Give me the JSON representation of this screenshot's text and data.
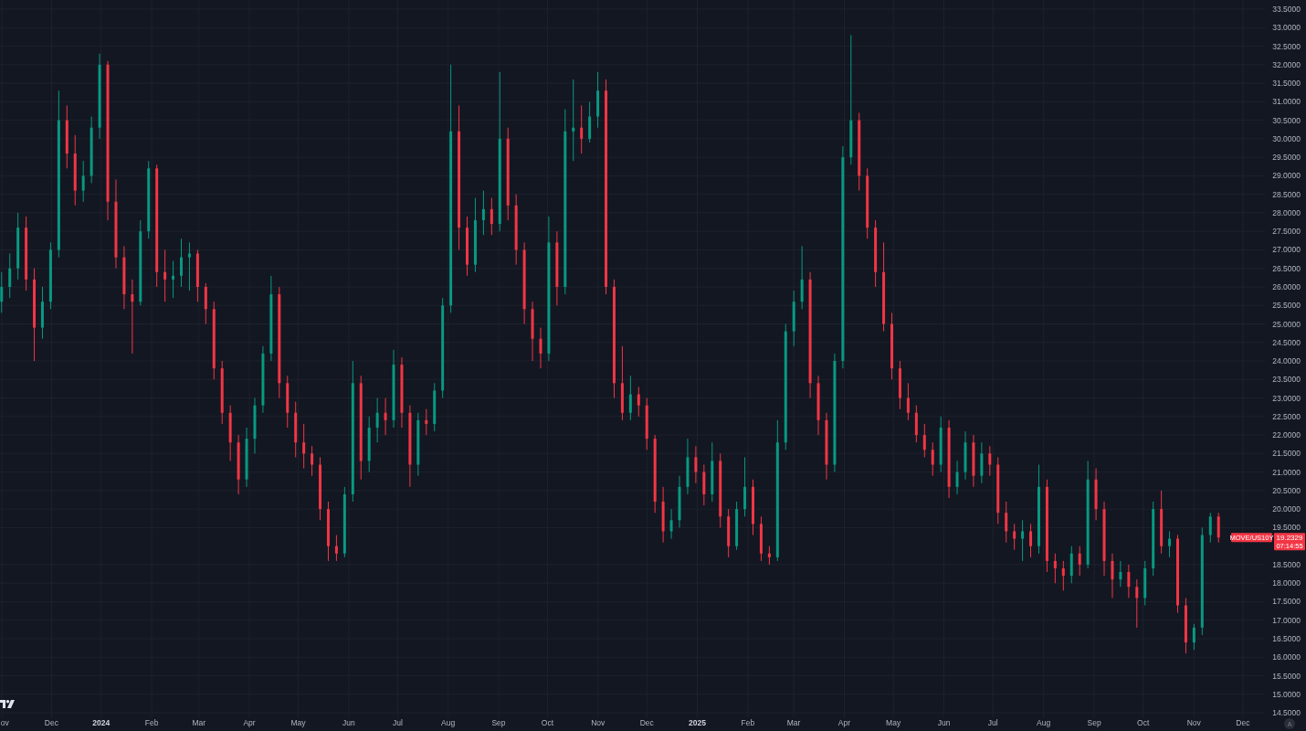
{
  "chart": {
    "chart_data": {
      "type": "candlestick",
      "grid": true,
      "xlim": [
        2023.8303,
        2025.9521
      ],
      "ylim": [
        14.378,
        33.747
      ],
      "x": [
        2023.833,
        2023.8467,
        2023.8604,
        2023.8741,
        2023.8878,
        2023.9015,
        2023.9152,
        2023.9289,
        2023.9426,
        2023.9563,
        2023.97,
        2023.9837,
        2023.9974,
        2024.0111,
        2024.0248,
        2024.0385,
        2024.0522,
        2024.0659,
        2024.0796,
        2024.0933,
        2024.107,
        2024.1207,
        2024.1344,
        2024.1481,
        2024.1618,
        2024.1755,
        2024.1892,
        2024.2029,
        2024.2166,
        2024.2303,
        2024.244,
        2024.2577,
        2024.2714,
        2024.2851,
        2024.2988,
        2024.3125,
        2024.3262,
        2024.3399,
        2024.3536,
        2024.3673,
        2024.381,
        2024.3947,
        2024.4084,
        2024.4221,
        2024.4358,
        2024.4495,
        2024.4632,
        2024.4769,
        2024.4906,
        2024.5043,
        2024.518,
        2024.5317,
        2024.5454,
        2024.5591,
        2024.5728,
        2024.5865,
        2024.6002,
        2024.6139,
        2024.6276,
        2024.6413,
        2024.655,
        2024.6687,
        2024.6824,
        2024.6961,
        2024.7098,
        2024.7235,
        2024.7372,
        2024.7509,
        2024.7646,
        2024.7783,
        2024.792,
        2024.8057,
        2024.8194,
        2024.8331,
        2024.8468,
        2024.8605,
        2024.8742,
        2024.8879,
        2024.9016,
        2024.9153,
        2024.929,
        2024.9427,
        2024.9564,
        2024.9701,
        2024.9838,
        2024.9975,
        2025.0112,
        2025.0249,
        2025.0386,
        2025.0523,
        2025.066,
        2025.0797,
        2025.0934,
        2025.1071,
        2025.1208,
        2025.1345,
        2025.1482,
        2025.1619,
        2025.1756,
        2025.1893,
        2025.203,
        2025.2167,
        2025.2304,
        2025.2441,
        2025.2578,
        2025.2715,
        2025.2852,
        2025.2989,
        2025.3126,
        2025.3263,
        2025.34,
        2025.3537,
        2025.3674,
        2025.3811,
        2025.3948,
        2025.4085,
        2025.4222,
        2025.4359,
        2025.4496,
        2025.4633,
        2025.477,
        2025.4907,
        2025.5044,
        2025.5181,
        2025.5318,
        2025.5455,
        2025.5592,
        2025.5729,
        2025.5866,
        2025.6003,
        2025.614,
        2025.6277,
        2025.6414,
        2025.6551,
        2025.6688,
        2025.6825,
        2025.6962,
        2025.7099,
        2025.7236,
        2025.7373,
        2025.751,
        2025.7647,
        2025.7784,
        2025.7921,
        2025.8058,
        2025.8195,
        2025.8332,
        2025.8469,
        2025.8606,
        2025.8743
      ],
      "series": [
        {
          "name": "MOVE/US10Y",
          "ohlc": [
            [
              25.6,
              26.4,
              25.3,
              26.0
            ],
            [
              26.0,
              26.9,
              25.7,
              26.5
            ],
            [
              26.5,
              28.0,
              26.2,
              27.6
            ],
            [
              27.6,
              27.9,
              25.9,
              26.2
            ],
            [
              26.2,
              26.5,
              24.0,
              24.9
            ],
            [
              24.9,
              26.0,
              24.6,
              25.6
            ],
            [
              25.6,
              27.2,
              25.4,
              27.0
            ],
            [
              27.0,
              31.3,
              26.8,
              30.5
            ],
            [
              30.5,
              30.9,
              29.2,
              29.6
            ],
            [
              29.6,
              30.1,
              28.2,
              28.6
            ],
            [
              28.6,
              29.4,
              28.3,
              29.0
            ],
            [
              29.0,
              30.6,
              28.8,
              30.3
            ],
            [
              30.3,
              32.3,
              30.0,
              32.0
            ],
            [
              32.0,
              32.1,
              27.8,
              28.3
            ],
            [
              28.3,
              28.9,
              26.5,
              26.8
            ],
            [
              26.8,
              27.1,
              25.4,
              25.8
            ],
            [
              25.8,
              26.2,
              24.2,
              25.6
            ],
            [
              25.6,
              27.8,
              25.5,
              27.5
            ],
            [
              27.5,
              29.4,
              27.3,
              29.2
            ],
            [
              29.2,
              29.3,
              26.0,
              26.4
            ],
            [
              26.4,
              27.0,
              25.6,
              26.2
            ],
            [
              26.2,
              26.7,
              25.7,
              26.3
            ],
            [
              26.3,
              27.3,
              26.0,
              26.8
            ],
            [
              26.8,
              27.2,
              25.9,
              26.9
            ],
            [
              26.9,
              27.0,
              25.6,
              26.0
            ],
            [
              26.0,
              26.1,
              25.0,
              25.4
            ],
            [
              25.4,
              25.6,
              23.5,
              23.8
            ],
            [
              23.8,
              24.0,
              22.3,
              22.6
            ],
            [
              22.6,
              22.8,
              21.3,
              21.8
            ],
            [
              21.8,
              22.0,
              20.4,
              20.8
            ],
            [
              20.8,
              22.2,
              20.6,
              21.9
            ],
            [
              21.9,
              23.0,
              21.5,
              22.8
            ],
            [
              22.8,
              24.4,
              22.6,
              24.2
            ],
            [
              24.2,
              26.3,
              24.0,
              25.8
            ],
            [
              25.8,
              26.0,
              23.0,
              23.4
            ],
            [
              23.4,
              23.6,
              22.2,
              22.6
            ],
            [
              22.6,
              22.9,
              21.4,
              21.8
            ],
            [
              21.8,
              22.3,
              21.1,
              21.5
            ],
            [
              21.5,
              21.7,
              20.9,
              21.2
            ],
            [
              21.2,
              21.4,
              19.7,
              20.0
            ],
            [
              20.0,
              20.2,
              18.6,
              19.0
            ],
            [
              19.0,
              19.3,
              18.6,
              18.8
            ],
            [
              18.8,
              20.6,
              18.7,
              20.4
            ],
            [
              20.4,
              24.0,
              20.2,
              23.4
            ],
            [
              23.4,
              23.6,
              20.8,
              21.3
            ],
            [
              21.3,
              22.5,
              21.0,
              22.2
            ],
            [
              22.2,
              23.0,
              21.8,
              22.6
            ],
            [
              22.6,
              23.0,
              22.0,
              22.4
            ],
            [
              22.4,
              24.3,
              22.2,
              23.9
            ],
            [
              23.9,
              24.1,
              22.2,
              22.6
            ],
            [
              22.6,
              22.8,
              20.6,
              21.2
            ],
            [
              21.2,
              22.6,
              20.9,
              22.4
            ],
            [
              22.4,
              22.7,
              22.0,
              22.3
            ],
            [
              22.3,
              23.4,
              22.1,
              23.2
            ],
            [
              23.2,
              25.7,
              23.0,
              25.5
            ],
            [
              25.5,
              32.0,
              25.3,
              30.2
            ],
            [
              30.2,
              30.9,
              27.0,
              27.6
            ],
            [
              27.6,
              27.9,
              26.3,
              26.6
            ],
            [
              26.6,
              28.4,
              26.4,
              27.8
            ],
            [
              27.8,
              28.6,
              27.4,
              28.1
            ],
            [
              28.1,
              28.4,
              27.4,
              27.7
            ],
            [
              27.7,
              31.8,
              27.5,
              30.0
            ],
            [
              30.0,
              30.3,
              27.8,
              28.2
            ],
            [
              28.2,
              28.5,
              26.6,
              27.0
            ],
            [
              27.0,
              27.2,
              25.0,
              25.4
            ],
            [
              25.4,
              25.6,
              24.0,
              24.6
            ],
            [
              24.6,
              24.9,
              23.8,
              24.2
            ],
            [
              24.2,
              27.9,
              24.0,
              27.2
            ],
            [
              27.2,
              27.5,
              25.5,
              26.0
            ],
            [
              26.0,
              30.8,
              25.8,
              30.2
            ],
            [
              30.2,
              31.6,
              29.4,
              30.3
            ],
            [
              30.3,
              30.9,
              29.6,
              30.0
            ],
            [
              30.0,
              31.0,
              29.9,
              30.6
            ],
            [
              30.6,
              31.8,
              30.3,
              31.3
            ],
            [
              31.3,
              31.6,
              25.8,
              26.0
            ],
            [
              26.0,
              26.2,
              23.0,
              23.4
            ],
            [
              23.4,
              24.4,
              22.4,
              22.6
            ],
            [
              22.6,
              23.6,
              22.4,
              23.1
            ],
            [
              23.1,
              23.3,
              22.5,
              22.8
            ],
            [
              22.8,
              23.0,
              21.6,
              21.9
            ],
            [
              21.9,
              22.0,
              19.9,
              20.2
            ],
            [
              20.2,
              20.6,
              19.1,
              19.4
            ],
            [
              19.4,
              20.0,
              19.2,
              19.7
            ],
            [
              19.7,
              20.9,
              19.5,
              20.6
            ],
            [
              20.6,
              21.9,
              20.4,
              21.4
            ],
            [
              21.4,
              21.7,
              20.7,
              21.0
            ],
            [
              21.0,
              21.2,
              20.1,
              20.4
            ],
            [
              20.4,
              21.8,
              20.2,
              21.3
            ],
            [
              21.3,
              21.5,
              19.5,
              19.8
            ],
            [
              19.8,
              20.0,
              18.7,
              19.0
            ],
            [
              19.0,
              20.2,
              18.9,
              20.0
            ],
            [
              20.0,
              21.4,
              19.8,
              20.6
            ],
            [
              20.6,
              20.8,
              19.3,
              19.6
            ],
            [
              19.6,
              19.8,
              18.6,
              18.8
            ],
            [
              18.8,
              19.0,
              18.5,
              18.7
            ],
            [
              18.7,
              22.4,
              18.6,
              21.8
            ],
            [
              21.8,
              25.0,
              21.6,
              24.8
            ],
            [
              24.8,
              25.9,
              24.4,
              25.6
            ],
            [
              25.6,
              27.1,
              25.4,
              26.2
            ],
            [
              26.2,
              26.4,
              23.0,
              23.4
            ],
            [
              23.4,
              23.6,
              22.0,
              22.4
            ],
            [
              22.4,
              22.6,
              20.8,
              21.2
            ],
            [
              21.2,
              24.2,
              21.0,
              24.0
            ],
            [
              24.0,
              29.8,
              23.8,
              29.5
            ],
            [
              29.5,
              32.8,
              29.3,
              30.5
            ],
            [
              30.5,
              30.7,
              28.6,
              29.0
            ],
            [
              29.0,
              29.2,
              27.3,
              27.6
            ],
            [
              27.6,
              27.8,
              26.0,
              26.4
            ],
            [
              26.4,
              27.2,
              24.8,
              25.0
            ],
            [
              25.0,
              25.3,
              23.5,
              23.8
            ],
            [
              23.8,
              24.0,
              22.7,
              23.0
            ],
            [
              23.0,
              23.4,
              22.4,
              22.6
            ],
            [
              22.6,
              22.8,
              21.8,
              22.0
            ],
            [
              22.0,
              22.3,
              21.4,
              21.6
            ],
            [
              21.6,
              21.8,
              20.9,
              21.2
            ],
            [
              21.2,
              22.5,
              21.0,
              22.2
            ],
            [
              22.2,
              22.4,
              20.3,
              20.6
            ],
            [
              20.6,
              21.3,
              20.4,
              21.0
            ],
            [
              21.0,
              22.1,
              20.8,
              21.8
            ],
            [
              21.8,
              22.0,
              20.6,
              20.9
            ],
            [
              20.9,
              21.8,
              20.7,
              21.5
            ],
            [
              21.5,
              21.7,
              20.9,
              21.2
            ],
            [
              21.2,
              21.4,
              19.6,
              19.9
            ],
            [
              19.9,
              20.2,
              19.1,
              19.4
            ],
            [
              19.4,
              19.6,
              18.9,
              19.2
            ],
            [
              19.2,
              19.7,
              18.6,
              19.4
            ],
            [
              19.4,
              19.6,
              18.7,
              19.0
            ],
            [
              19.0,
              21.2,
              18.8,
              20.6
            ],
            [
              20.6,
              20.8,
              18.3,
              18.6
            ],
            [
              18.6,
              18.8,
              18.0,
              18.4
            ],
            [
              18.4,
              18.6,
              17.8,
              18.2
            ],
            [
              18.2,
              19.0,
              18.0,
              18.8
            ],
            [
              18.8,
              19.0,
              18.2,
              18.5
            ],
            [
              18.5,
              21.3,
              18.4,
              20.8
            ],
            [
              20.8,
              21.1,
              19.7,
              20.0
            ],
            [
              20.0,
              20.2,
              18.2,
              18.6
            ],
            [
              18.6,
              18.8,
              17.6,
              18.1
            ],
            [
              18.1,
              18.6,
              17.9,
              18.3
            ],
            [
              18.3,
              18.5,
              17.6,
              17.9
            ],
            [
              17.9,
              18.1,
              16.8,
              17.6
            ],
            [
              17.6,
              18.6,
              17.4,
              18.4
            ],
            [
              18.4,
              20.2,
              18.2,
              20.0
            ],
            [
              20.0,
              20.5,
              18.8,
              19.0
            ],
            [
              19.0,
              19.4,
              18.7,
              19.2
            ],
            [
              19.2,
              19.3,
              17.2,
              17.4
            ],
            [
              17.4,
              17.6,
              16.1,
              16.4
            ],
            [
              16.4,
              16.9,
              16.2,
              16.8
            ],
            [
              16.8,
              19.5,
              16.6,
              19.3
            ],
            [
              19.3,
              19.9,
              19.1,
              19.8
            ],
            [
              19.8,
              19.9,
              19.1,
              19.2329
            ]
          ]
        }
      ],
      "xticks": [
        {
          "value": 2023.8333,
          "label": "ov"
        },
        {
          "value": 2023.9167,
          "label": "Dec"
        },
        {
          "value": 2024,
          "label": "2024"
        },
        {
          "value": 2024.0847,
          "label": "Feb"
        },
        {
          "value": 2024.1639,
          "label": "Mar"
        },
        {
          "value": 2024.2486,
          "label": "Apr"
        },
        {
          "value": 2024.3306,
          "label": "May"
        },
        {
          "value": 2024.4153,
          "label": "Jun"
        },
        {
          "value": 2024.4973,
          "label": "Jul"
        },
        {
          "value": 2024.582,
          "label": "Aug"
        },
        {
          "value": 2024.6667,
          "label": "Sep"
        },
        {
          "value": 2024.7486,
          "label": "Oct"
        },
        {
          "value": 2024.8333,
          "label": "Nov"
        },
        {
          "value": 2024.9153,
          "label": "Dec"
        },
        {
          "value": 2025,
          "label": "2025"
        },
        {
          "value": 2025.0849,
          "label": "Feb"
        },
        {
          "value": 2025.1616,
          "label": "Mar"
        },
        {
          "value": 2025.2466,
          "label": "Apr"
        },
        {
          "value": 2025.3288,
          "label": "May"
        },
        {
          "value": 2025.4137,
          "label": "Jun"
        },
        {
          "value": 2025.4959,
          "label": "Jul"
        },
        {
          "value": 2025.5808,
          "label": "Aug"
        },
        {
          "value": 2025.6658,
          "label": "Sep"
        },
        {
          "value": 2025.7479,
          "label": "Oct"
        },
        {
          "value": 2025.8329,
          "label": "Nov"
        },
        {
          "value": 2025.9151,
          "label": "Dec"
        }
      ],
      "yticks": [
        {
          "value": 33.5,
          "label": "33.5000"
        },
        {
          "value": 33,
          "label": "33.0000"
        },
        {
          "value": 32.5,
          "label": "32.5000"
        },
        {
          "value": 32,
          "label": "32.0000"
        },
        {
          "value": 31.5,
          "label": "31.5000"
        },
        {
          "value": 31,
          "label": "31.0000"
        },
        {
          "value": 30.5,
          "label": "30.5000"
        },
        {
          "value": 30,
          "label": "30.0000"
        },
        {
          "value": 29.5,
          "label": "29.5000"
        },
        {
          "value": 29,
          "label": "29.0000"
        },
        {
          "value": 28.5,
          "label": "28.5000"
        },
        {
          "value": 28,
          "label": "28.0000"
        },
        {
          "value": 27.5,
          "label": "27.5000"
        },
        {
          "value": 27,
          "label": "27.0000"
        },
        {
          "value": 26.5,
          "label": "26.5000"
        },
        {
          "value": 26,
          "label": "26.0000"
        },
        {
          "value": 25.5,
          "label": "25.5000"
        },
        {
          "value": 25,
          "label": "25.0000"
        },
        {
          "value": 24.5,
          "label": "24.5000"
        },
        {
          "value": 24,
          "label": "24.0000"
        },
        {
          "value": 23.5,
          "label": "23.5000"
        },
        {
          "value": 23,
          "label": "23.0000"
        },
        {
          "value": 22.5,
          "label": "22.5000"
        },
        {
          "value": 22,
          "label": "22.0000"
        },
        {
          "value": 21.5,
          "label": "21.5000"
        },
        {
          "value": 21,
          "label": "21.0000"
        },
        {
          "value": 20.5,
          "label": "20.5000"
        },
        {
          "value": 20,
          "label": "20.0000"
        },
        {
          "value": 19.5,
          "label": "19.5000"
        },
        {
          "value": 18.5,
          "label": "18.5000"
        },
        {
          "value": 18,
          "label": "18.0000"
        },
        {
          "value": 17.5,
          "label": "17.5000"
        },
        {
          "value": 17,
          "label": "17.0000"
        },
        {
          "value": 16.5,
          "label": "16.5000"
        },
        {
          "value": 16,
          "label": "16.0000"
        },
        {
          "value": 15.5,
          "label": "15.5000"
        },
        {
          "value": 15,
          "label": "15.0000"
        },
        {
          "value": 14.5,
          "label": "14.5000"
        }
      ]
    },
    "last_price": {
      "price": "19.2329",
      "countdown": "07:14:55",
      "color": "#f23645"
    },
    "auto_scale_button": {
      "label": "A"
    }
  }
}
